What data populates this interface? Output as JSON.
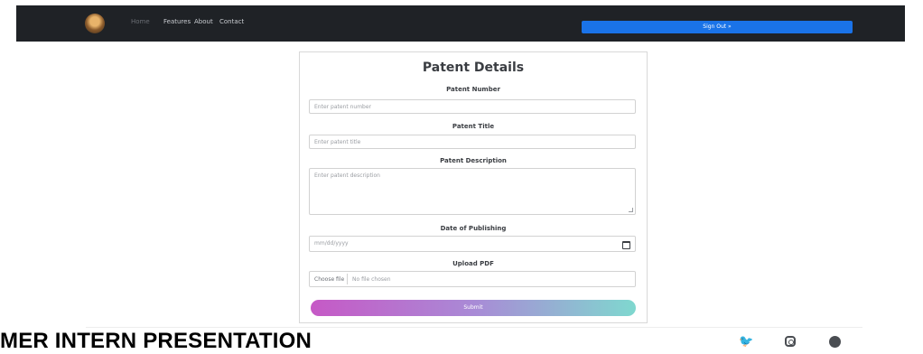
{
  "navbar": {
    "links": [
      {
        "label": "Home"
      },
      {
        "label": "Features"
      },
      {
        "label": "About"
      },
      {
        "label": "Contact"
      }
    ],
    "signout_label": "Sign Out »"
  },
  "form": {
    "title": "Patent Details",
    "fields": {
      "patent_number": {
        "label": "Patent Number",
        "placeholder": "Enter patent number"
      },
      "patent_title": {
        "label": "Patent Title",
        "placeholder": "Enter patent title"
      },
      "patent_description": {
        "label": "Patent Description",
        "placeholder": "Enter patent description"
      },
      "date_of_publishing": {
        "label": "Date of Publishing",
        "placeholder": "mm/dd/yyyy"
      },
      "upload_pdf": {
        "label": "Upload PDF",
        "button_label": "Choose file",
        "status": "No file chosen"
      }
    },
    "submit_label": "Submit"
  },
  "footer": {
    "presentation_title": "MER INTERN PRESENTATION",
    "social_icons": [
      "twitter-icon",
      "instagram-icon",
      "github-icon"
    ]
  },
  "colors": {
    "navbar_bg": "#1f2226",
    "signout_bg": "#1a73e8",
    "submit_gradient": [
      "#c659c6",
      "#a98ad6",
      "#7fd8cf"
    ]
  }
}
